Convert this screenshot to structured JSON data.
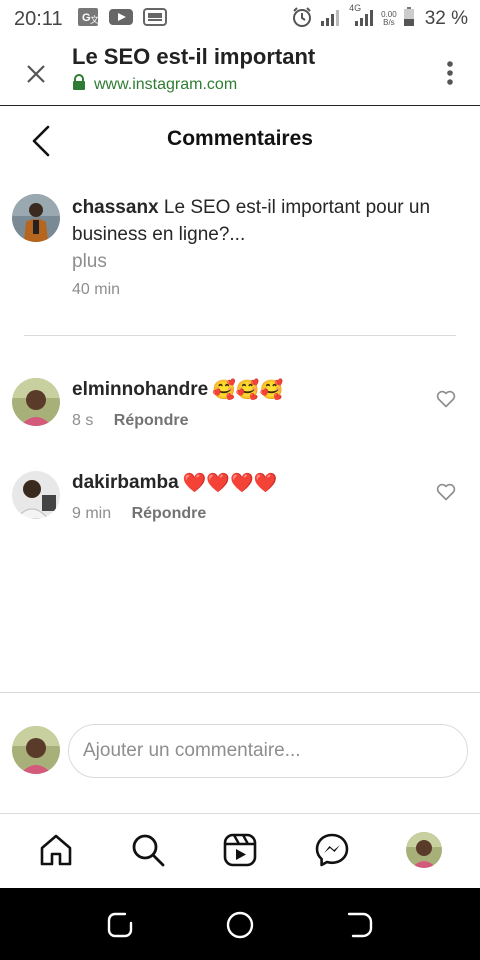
{
  "status_bar": {
    "time": "20:11",
    "net_speed_value": "0.00",
    "net_speed_unit": "B/s",
    "network_type": "4G",
    "battery": "32 %"
  },
  "browser": {
    "title": "Le SEO est-il important",
    "url": "www.instagram.com"
  },
  "header": {
    "title": "Commentaires"
  },
  "caption": {
    "username": "chassanx",
    "text": "Le SEO est-il important pour un business en ligne?...",
    "more": "plus",
    "time": "40 min"
  },
  "comments": [
    {
      "username": "elminnohandre",
      "emoji": "🥰🥰🥰",
      "time": "8 s",
      "reply": "Répondre"
    },
    {
      "username": "dakirbamba",
      "emoji": "❤️❤️❤️❤️",
      "time": "9 min",
      "reply": "Répondre"
    }
  ],
  "composer": {
    "placeholder": "Ajouter un commentaire..."
  },
  "colors": {
    "url_green": "#2e7d32",
    "muted": "#8e8e8e",
    "heart_red": "#e0245e"
  }
}
